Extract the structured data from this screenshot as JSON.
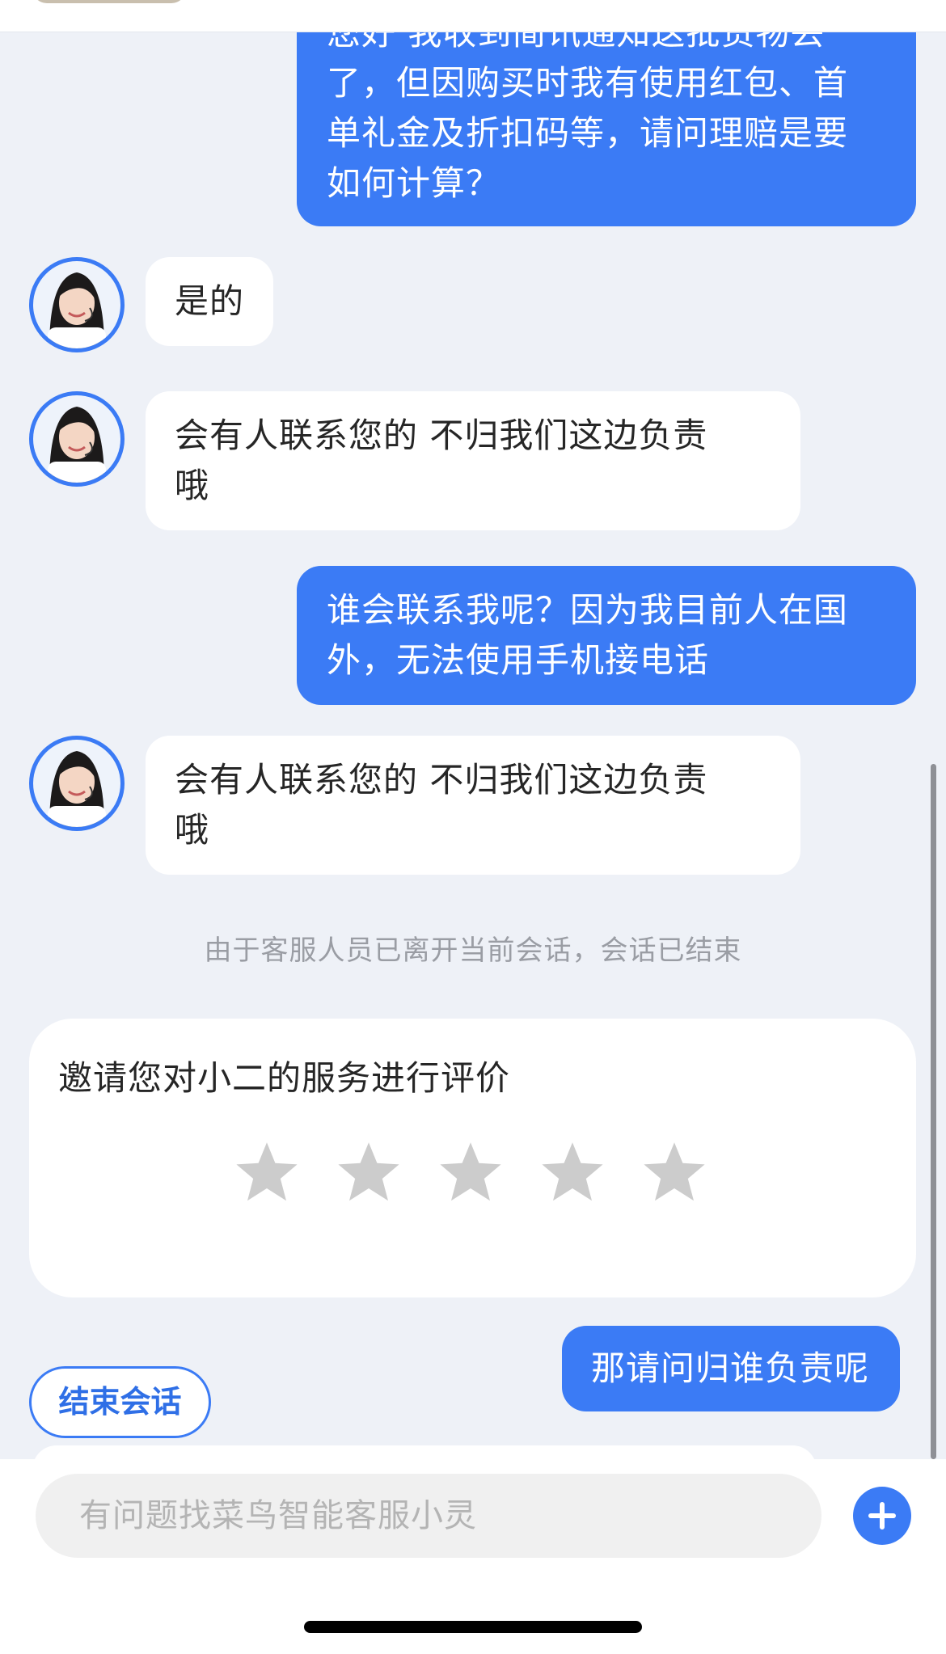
{
  "messages": [
    {
      "side": "out",
      "lines": [
        "您好 我收到简讯通知这批货物丢",
        "了，但因购买时我有使用红包、首",
        "单礼金及折扣码等，请问理赔是要",
        "如何计算？"
      ]
    },
    {
      "side": "in",
      "lines": [
        "是的"
      ]
    },
    {
      "side": "in",
      "lines": [
        "会有人联系您的 不归我们这边负责",
        "哦"
      ]
    },
    {
      "side": "out",
      "lines": [
        "谁会联系我呢？因为我目前人在国",
        "外，无法使用手机接电话"
      ]
    },
    {
      "side": "in",
      "lines": [
        "会有人联系您的 不归我们这边负责",
        "哦"
      ]
    },
    {
      "side": "out",
      "lines": [
        "那请问归谁负责呢"
      ]
    }
  ],
  "system_note": "由于客服人员已离开当前会话，会话已结束",
  "rating": {
    "title": "邀请您对小二的服务进行评价",
    "max_stars": 5,
    "selected_stars": 0
  },
  "end_button": "结束会话",
  "input": {
    "placeholder": "有问题找菜鸟智能客服小灵",
    "value": ""
  },
  "colors": {
    "accent": "#3b7bf5",
    "star_inactive": "#cccccc",
    "background": "#eef1f7"
  },
  "icons": {
    "plus": "plus-circle-icon",
    "star": "star-icon",
    "avatar": "agent-avatar"
  }
}
